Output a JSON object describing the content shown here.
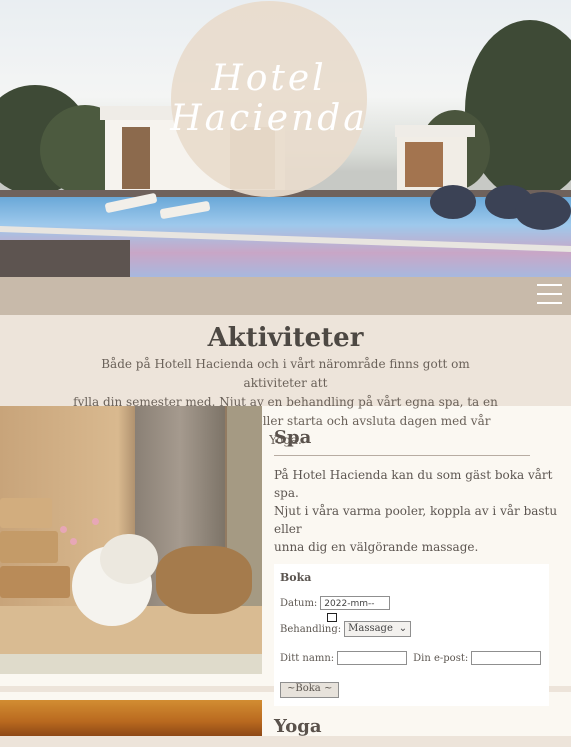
{
  "logo": {
    "line1": "Hotel",
    "line2": "Hacienda"
  },
  "intro": {
    "title": "Aktiviteter",
    "line1": "Både på Hotell Hacienda och i vårt närområde finns gott om aktiviteter att",
    "line2": "fylla din semester med. Njut av en behandling på vårt egna spa, ta en",
    "line3": "promenad i vår vackra miljö eller starta och avsluta dagen med vår Yoga."
  },
  "spa": {
    "heading": "Spa",
    "line1": "På Hotel Hacienda kan du som gäst boka vårt spa.",
    "line2": "Njut i våra varma pooler, koppla av i vår bastu eller",
    "line3": "unna dig en välgörande massage.",
    "booking": {
      "title": "Boka",
      "date_label": "Datum:",
      "date_value": "2022-mm--",
      "treatment_label": "Behandling:",
      "treatment_value": "Massage",
      "name_label": "Ditt namn:",
      "email_label": "Din e-post:",
      "submit": "~Boka ~"
    }
  },
  "yoga": {
    "heading": "Yoga"
  },
  "colors": {
    "navbar": "#c8baaa",
    "background": "#ede4da",
    "card": "#fbf8f2",
    "logo_circle": "#e8dbcc"
  }
}
